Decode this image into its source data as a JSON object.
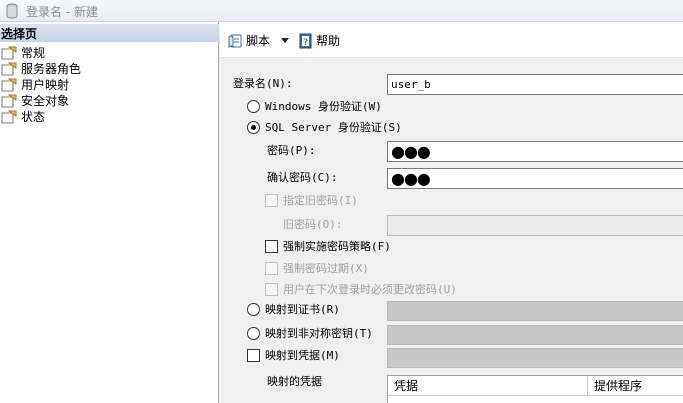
{
  "window": {
    "title": "登录名 - 新建"
  },
  "left_pane": {
    "header": "选择页",
    "pages": [
      {
        "label": "常规"
      },
      {
        "label": "服务器角色"
      },
      {
        "label": "用户映射"
      },
      {
        "label": "安全对象"
      },
      {
        "label": "状态"
      }
    ]
  },
  "toolbar": {
    "script_label": "脚本",
    "help_label": "帮助"
  },
  "form": {
    "login_name_label": "登录名(N):",
    "login_name_value": "user_b",
    "windows_auth_label": "Windows 身份验证(W)",
    "sql_auth_label": "SQL Server 身份验证(S)",
    "password_label": "密码(P):",
    "password_value": "●●●",
    "confirm_password_label": "确认密码(C):",
    "confirm_password_value": "●●●",
    "specify_old_password_label": "指定旧密码(I)",
    "old_password_label": "旧密码(O):",
    "enforce_policy_label": "强制实施密码策略(F)",
    "enforce_expiration_label": "强制密码过期(X)",
    "must_change_label": "用户在下次登录时必须更改密码(U)",
    "map_certificate_label": "映射到证书(R)",
    "map_asym_key_label": "映射到非对称密钥(T)",
    "map_credential_label": "映射到凭据(M)",
    "mapped_credentials_label": "映射的凭据",
    "grid_columns": [
      "凭据",
      "提供程序"
    ]
  },
  "state": {
    "authentication": "SQL Server",
    "enforce_policy_checked": false
  }
}
